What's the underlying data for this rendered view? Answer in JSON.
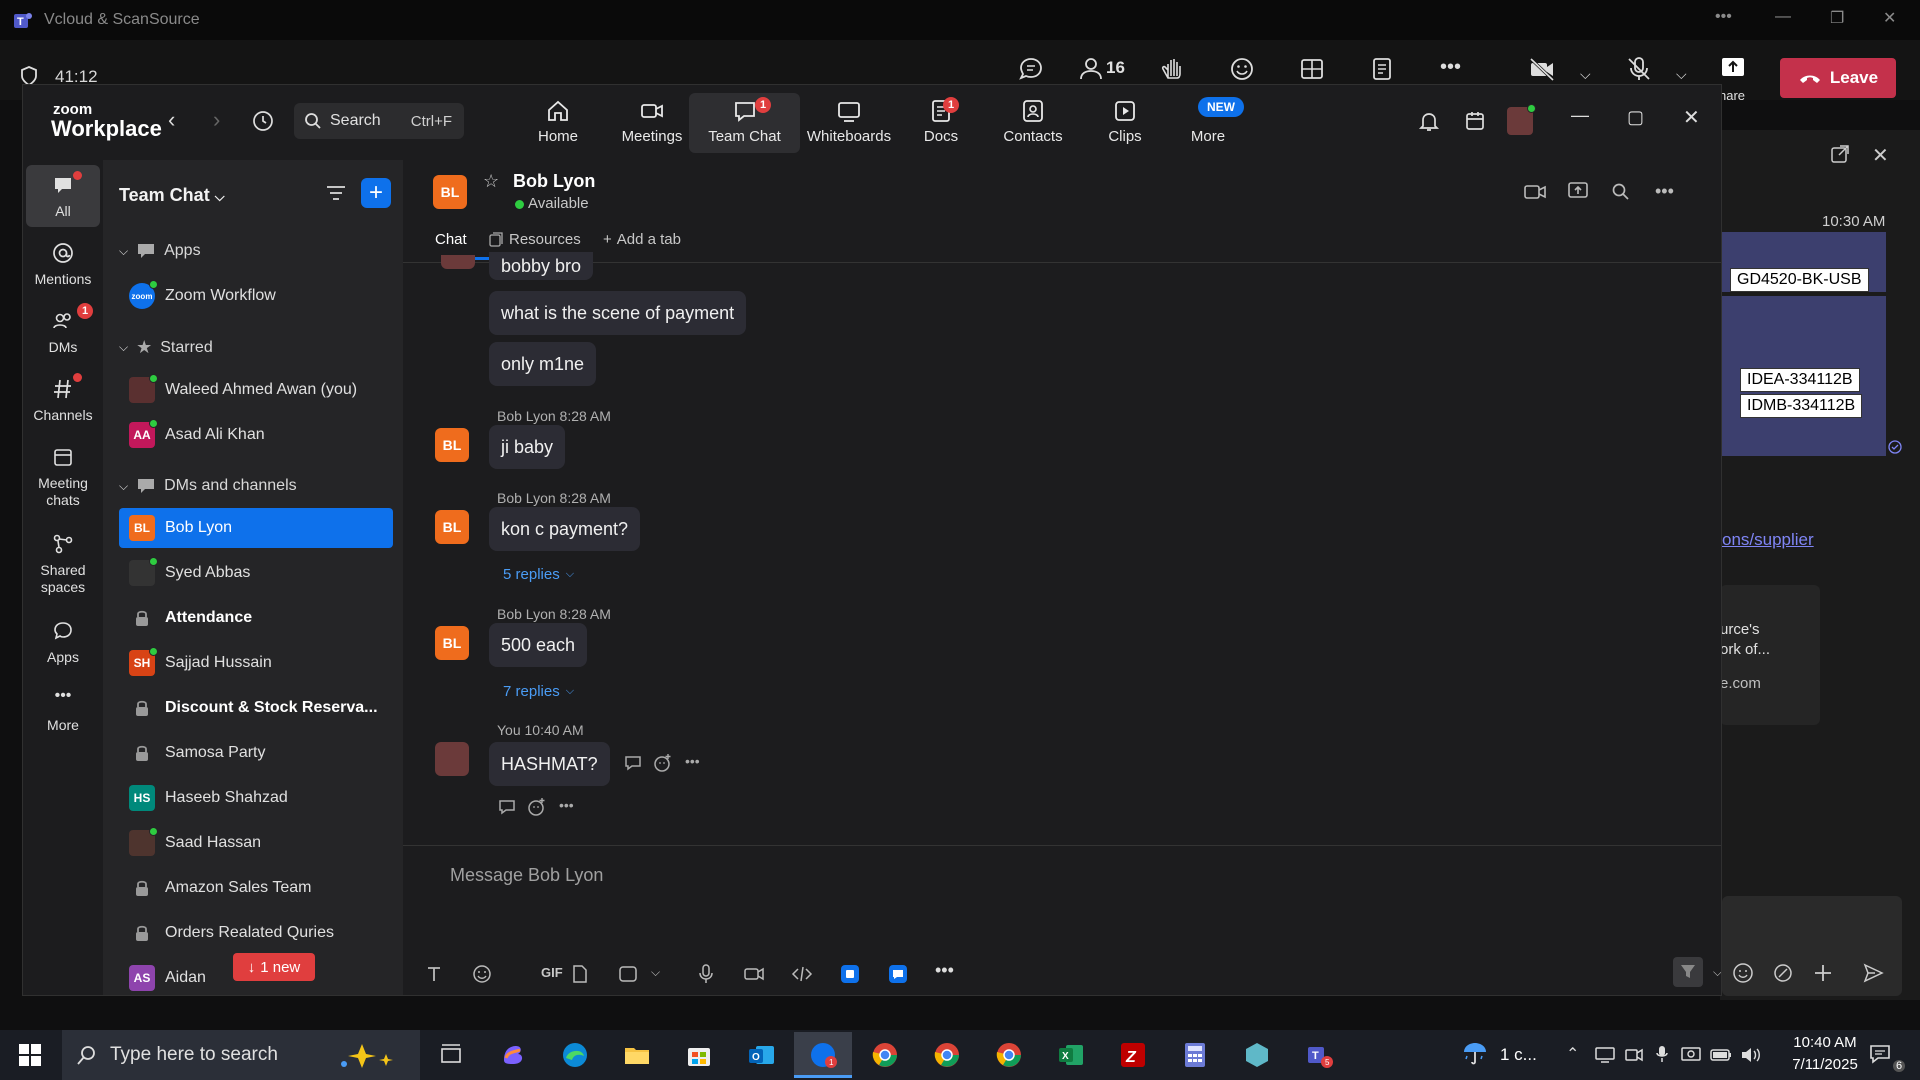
{
  "teams": {
    "window_title": "Vcloud & ScanSource",
    "timer": "41:12",
    "participants_count": "16",
    "leave_label": "Leave",
    "share_label": "hare",
    "right_panel": {
      "time": "10:30 AM",
      "code1": "GD4520-BK-USB",
      "code2": "IDEA-334112B",
      "code3": "IDMB-334112B",
      "link_text": "ons/supplier",
      "snippet_line1": "urce's",
      "snippet_line2": "ork of...",
      "snippet_domain": "e.com"
    }
  },
  "zoom": {
    "logo_top": "zoom",
    "logo_bottom": "Workplace",
    "search": {
      "label": "Search",
      "shortcut": "Ctrl+F"
    },
    "nav": [
      {
        "label": "Home",
        "icon": "home-icon"
      },
      {
        "label": "Meetings",
        "icon": "video-icon"
      },
      {
        "label": "Team Chat",
        "icon": "chat-icon",
        "badge": "1"
      },
      {
        "label": "Whiteboards",
        "icon": "whiteboard-icon"
      },
      {
        "label": "Docs",
        "icon": "docs-icon",
        "badge": "1"
      },
      {
        "label": "Contacts",
        "icon": "contacts-icon"
      },
      {
        "label": "Clips",
        "icon": "clips-icon"
      },
      {
        "label": "More",
        "icon": "more-icon",
        "tag": "NEW"
      }
    ],
    "rail": [
      {
        "label": "All"
      },
      {
        "label": "Mentions"
      },
      {
        "label": "DMs",
        "badge": "1"
      },
      {
        "label": "Channels"
      },
      {
        "label": "Meeting chats"
      },
      {
        "label": "Shared spaces"
      },
      {
        "label": "Apps"
      },
      {
        "label": "More"
      }
    ],
    "chat_list": {
      "title": "Team Chat",
      "sections": {
        "apps": "Apps",
        "starred": "Starred",
        "dms": "DMs and channels"
      },
      "apps_items": [
        "Zoom Workflow"
      ],
      "starred_items": [
        {
          "name": "Waleed Ahmed Awan (you)"
        },
        {
          "name": "Asad Ali Khan",
          "initials": "AA"
        }
      ],
      "dm_items": [
        {
          "name": "Bob Lyon",
          "initials": "BL"
        },
        {
          "name": "Syed Abbas"
        },
        {
          "name": "Attendance"
        },
        {
          "name": "Sajjad Hussain",
          "initials": "SH"
        },
        {
          "name": "Discount & Stock Reserva..."
        },
        {
          "name": "Samosa Party"
        },
        {
          "name": "Haseeb Shahzad",
          "initials": "HS"
        },
        {
          "name": "Saad Hassan"
        },
        {
          "name": "Amazon Sales Team"
        },
        {
          "name": "Orders Realated Quries"
        },
        {
          "name": "Aidan",
          "initials": "AS"
        }
      ],
      "new_pill": "1 new"
    },
    "conversation": {
      "contact_name": "Bob Lyon",
      "contact_initials": "BL",
      "status": "Available",
      "tabs": [
        "Chat",
        "Resources",
        "Add a tab"
      ],
      "messages": [
        {
          "text": "bobby bro"
        },
        {
          "text": "what is the scene of payment"
        },
        {
          "text": "only m1ne"
        },
        {
          "meta": "Bob Lyon 8:28 AM",
          "text": "ji baby"
        },
        {
          "meta": "Bob Lyon 8:28 AM",
          "text": "kon c payment?",
          "replies": "5 replies"
        },
        {
          "meta": "Bob Lyon 8:28 AM",
          "text": "500 each",
          "replies": "7 replies"
        },
        {
          "meta": "You 10:40 AM",
          "text": "HASHMAT?"
        }
      ],
      "composer_placeholder": "Message Bob Lyon",
      "gif_label": "GIF"
    }
  },
  "taskbar": {
    "search_placeholder": "Type here to search",
    "weather": "1 c...",
    "time": "10:40 AM",
    "date": "7/11/2025",
    "notification_count": "6"
  },
  "colors": {
    "accent": "#0e71eb",
    "leave": "#c4314b",
    "badge": "#e03e3e",
    "avatar_orange": "#ef6c1d",
    "presence": "#2ecc40"
  }
}
